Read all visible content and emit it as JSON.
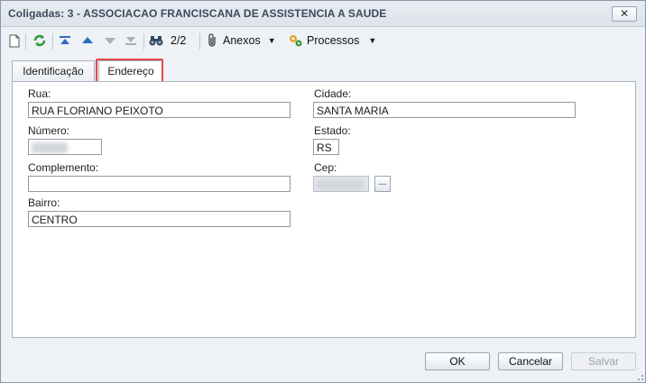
{
  "window": {
    "title": "Coligadas: 3 - ASSOCIACAO FRANCISCANA DE ASSISTENCIA  A SAUDE",
    "close_label": "✕"
  },
  "toolbar": {
    "record_position": "2/2",
    "anexos_label": "Anexos",
    "processos_label": "Processos",
    "dropdown_glyph": "▼"
  },
  "tabs": [
    {
      "label": "Identificação"
    },
    {
      "label": "Endereço"
    }
  ],
  "form": {
    "rua": {
      "label": "Rua:",
      "value": "RUA FLORIANO PEIXOTO"
    },
    "numero": {
      "label": "Número:",
      "value": ""
    },
    "complemento": {
      "label": "Complemento:",
      "value": ""
    },
    "bairro": {
      "label": "Bairro:",
      "value": "CENTRO"
    },
    "cidade": {
      "label": "Cidade:",
      "value": "SANTA MARIA"
    },
    "estado": {
      "label": "Estado:",
      "value": "RS"
    },
    "cep": {
      "label": "Cep:",
      "value": "",
      "lookup_label": "..."
    }
  },
  "buttons": {
    "ok": "OK",
    "cancel": "Cancelar",
    "save": "Salvar"
  },
  "colors": {
    "highlight": "#e0474c",
    "accent": "#2b6cc4"
  }
}
